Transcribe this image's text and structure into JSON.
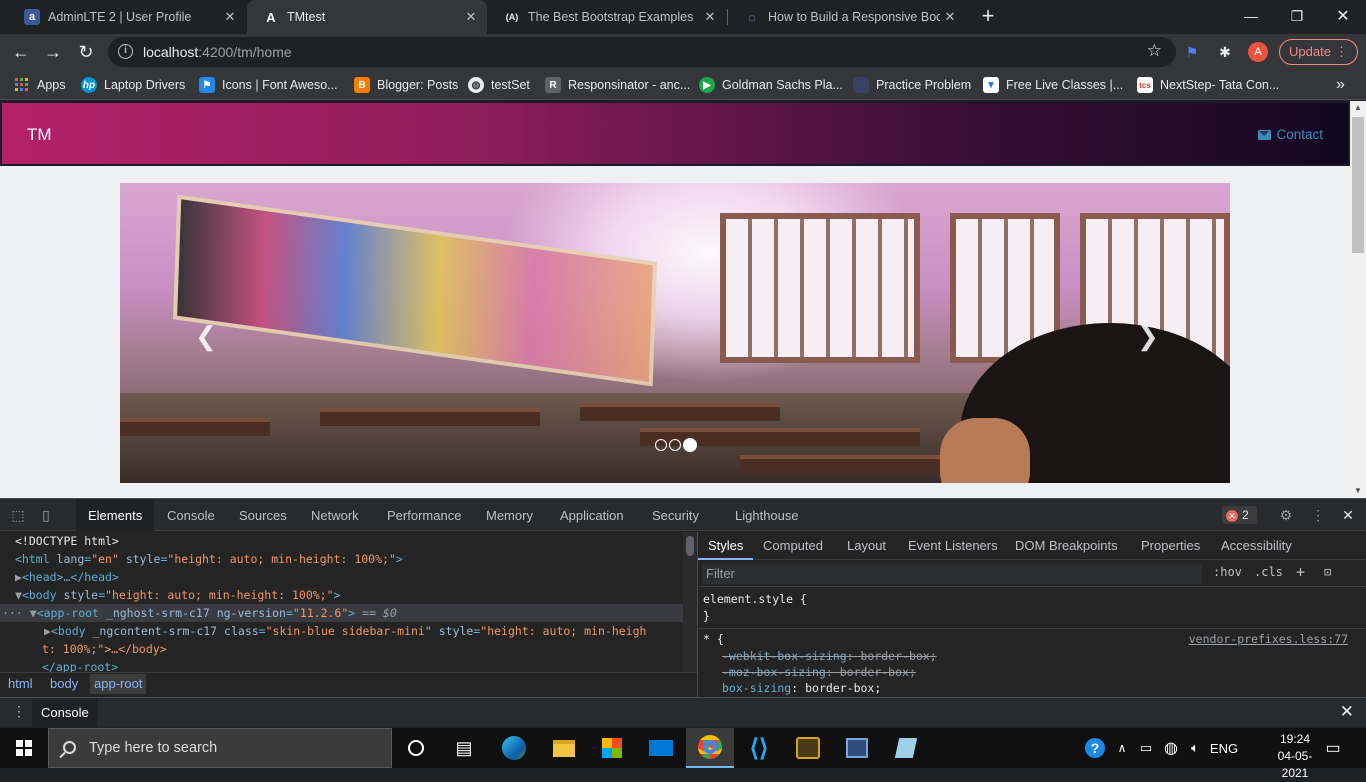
{
  "browser": {
    "tabs": [
      {
        "title": "AdminLTE 2 | User Profile",
        "icon": "adminlte-a-icon"
      },
      {
        "title": "TMtest",
        "icon": "angular-icon"
      },
      {
        "title": "The Best Bootstrap Examples",
        "icon": "angular-alt-icon"
      },
      {
        "title": "How to Build a Responsive Bootst",
        "icon": "loading-icon"
      }
    ],
    "url_host": "localhost",
    "url_path": ":4200/tm/home",
    "update_label": "Update",
    "avatar_letter": "A",
    "bookmarks": [
      {
        "label": "Apps",
        "icon": "apps-grid-icon"
      },
      {
        "label": "Laptop Drivers",
        "icon": "hp-icon"
      },
      {
        "label": "Icons | Font Aweso...",
        "icon": "font-awesome-flag-icon"
      },
      {
        "label": "Blogger: Posts",
        "icon": "blogger-icon"
      },
      {
        "label": "testSet",
        "icon": "globe-icon"
      },
      {
        "label": "Responsinator - anc...",
        "icon": "r-icon"
      },
      {
        "label": "Goldman Sachs Pla...",
        "icon": "hackerrank-icon"
      },
      {
        "label": "Practice Problem",
        "icon": "codechef-icon"
      },
      {
        "label": "Free Live Classes |...",
        "icon": "shield-icon"
      },
      {
        "label": "NextStep- Tata Con...",
        "icon": "tcs-icon"
      }
    ]
  },
  "page": {
    "brand": "TM",
    "contact_label": "Contact",
    "carousel": {
      "slide_count": 3,
      "active_index": 2
    }
  },
  "devtools": {
    "tabs": [
      "Elements",
      "Console",
      "Sources",
      "Network",
      "Performance",
      "Memory",
      "Application",
      "Security",
      "Lighthouse"
    ],
    "active_tab": "Elements",
    "error_count": "2",
    "dom": {
      "doctype": "<!DOCTYPE html>",
      "html_tag": "<html ",
      "html_attr1": "lang",
      "html_val1": "\"en\"",
      "html_attr2": "style",
      "html_val2": "\"height: auto; min-height: 100%;\"",
      "head_line": "<head>…</head>",
      "body_tag": "<body ",
      "body_attr": "style",
      "body_val": "\"height: auto; min-height: 100%;\"",
      "approot_tag": "<app-root ",
      "approot_attr1": "_nghost-srm-c17",
      "approot_attr2": "ng-version",
      "approot_val2": "\"11.2.6\"",
      "approot_eq": "== $0",
      "inner_body_tag": "<body ",
      "inner_body_attr1": "_ngcontent-srm-c17",
      "inner_body_attr2": "class",
      "inner_body_val2": "\"skin-blue sidebar-mini\"",
      "inner_body_attr3": "style",
      "inner_body_val3": "\"height: auto; min-heigh",
      "inner_body_cont": "t: 100%;\">…</body>",
      "approot_close": "</app-root>"
    },
    "breadcrumbs": [
      "html",
      "body",
      "app-root"
    ],
    "styles_tabs": [
      "Styles",
      "Computed",
      "Layout",
      "Event Listeners",
      "DOM Breakpoints",
      "Properties",
      "Accessibility"
    ],
    "filter_placeholder": "Filter",
    "hov_label": ":hov",
    "cls_label": ".cls",
    "element_style": "element.style {",
    "close_brace": "}",
    "universal_selector": "* {",
    "rule_source": "vendor-prefixes.less:77",
    "decls": [
      {
        "prop": "-webkit-box-sizing",
        "value": "border-box;"
      },
      {
        "prop": "-moz-box-sizing",
        "value": "border-box;"
      },
      {
        "prop": "box-sizing",
        "value": "border-box;"
      }
    ],
    "drawer_tab": "Console"
  },
  "taskbar": {
    "search_placeholder": "Type here to search",
    "language": "ENG",
    "time": "19:24",
    "date": "04-05-2021"
  }
}
